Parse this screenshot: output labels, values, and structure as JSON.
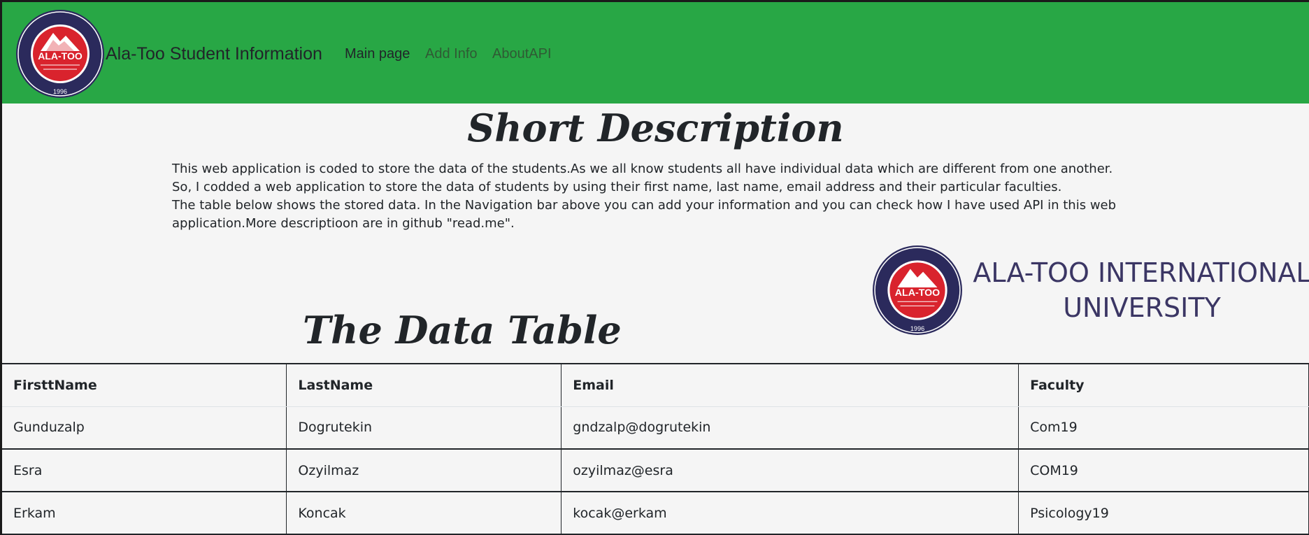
{
  "navbar": {
    "logo": {
      "text": "ALA-TOO",
      "year": "1996",
      "ring": "ALA-TOO INTERNATIONAL UNIVERSITY"
    },
    "brand": "Ala-Too Student Information",
    "links": [
      "Main page",
      "Add Info",
      "AboutAPI"
    ]
  },
  "main": {
    "title": "Short Description",
    "description": [
      "This web application is coded to store the data of the students.As we all know students all have individual data which are different from one another.",
      "So, I codded a web application to store the data of students by using their first name, last name, email address and their particular faculties.",
      "The table below shows the stored data. In the Navigation bar above you can add your information and you can check how I have used API in this web application.More descriptioon are in github \"read.me\"."
    ],
    "university": {
      "line1": "ALA-TOO INTERNATIONAL",
      "line2": "UNIVERSITY"
    },
    "table_title": "The Data Table"
  },
  "table": {
    "headers": [
      "FirsttName",
      "LastName",
      "Email",
      "Faculty"
    ],
    "rows": [
      [
        "Gunduzalp",
        "Dogrutekin",
        "gndzalp@dogrutekin",
        "Com19"
      ],
      [
        "Esra",
        "Ozyilmaz",
        "ozyilmaz@esra",
        "COM19"
      ],
      [
        "Erkam",
        "Koncak",
        "kocak@erkam",
        "Psicology19"
      ]
    ]
  },
  "colors": {
    "navbar": "#28a745",
    "logo_red": "#d9232d",
    "logo_navy": "#2b2a5c"
  }
}
